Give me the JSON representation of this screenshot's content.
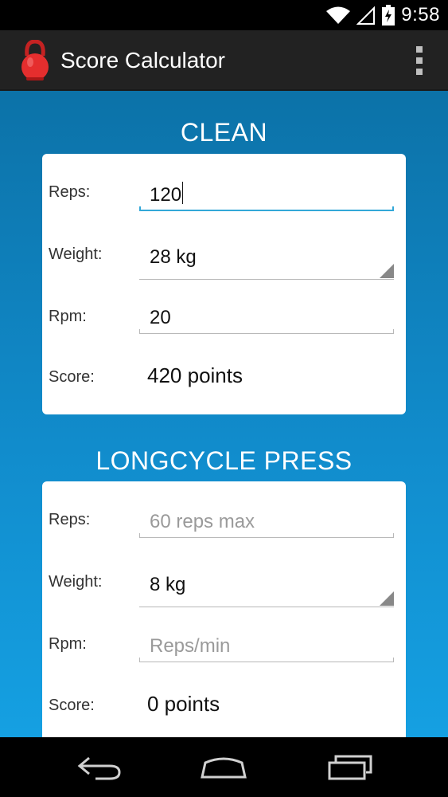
{
  "status_bar": {
    "time": "9:58",
    "icons": [
      "wifi-icon",
      "signal-icon",
      "battery-charging-icon"
    ]
  },
  "action_bar": {
    "title": "Score Calculator",
    "app_icon": "kettlebell-icon",
    "menu_icon": "overflow-menu-icon"
  },
  "clean": {
    "title": "CLEAN",
    "reps_label": "Reps:",
    "reps_value": "120",
    "weight_label": "Weight:",
    "weight_value": "28 kg",
    "rpm_label": "Rpm:",
    "rpm_value": "20",
    "score_label": "Score:",
    "score_value": "420 points"
  },
  "longcycle": {
    "title": "LONGCYCLE PRESS",
    "reps_label": "Reps:",
    "reps_placeholder": "60 reps max",
    "weight_label": "Weight:",
    "weight_value": "8 kg",
    "rpm_label": "Rpm:",
    "rpm_placeholder": "Reps/min",
    "score_label": "Score:",
    "score_value": "0 points"
  },
  "nav_bar": {
    "icons": [
      "back-icon",
      "home-icon",
      "recent-apps-icon"
    ]
  },
  "colors": {
    "accent": "#33a8d8",
    "background_top": "#0c72a8",
    "background_bottom": "#15a0e2",
    "kettlebell": "#e52e2e"
  }
}
